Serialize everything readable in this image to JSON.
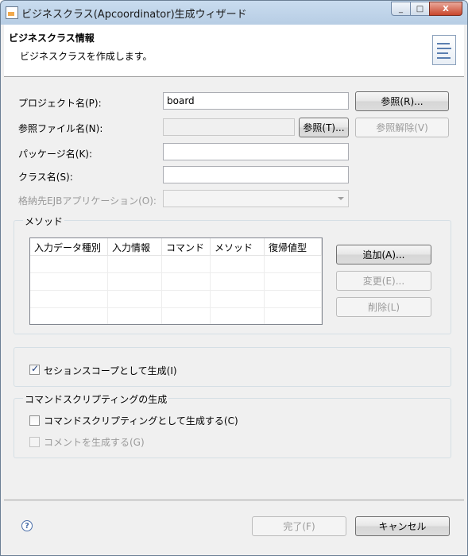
{
  "window": {
    "title": "ビジネスクラス(Apcoordinator)生成ウィザード",
    "minimize": "_",
    "maximize": "□",
    "close": "X"
  },
  "header": {
    "title": "ビジネスクラス情報",
    "description": "ビジネスクラスを作成します。"
  },
  "form": {
    "project_label": "プロジェクト名(P):",
    "project_value": "board",
    "browse_button": "参照(R)...",
    "ref_file_label": "参照ファイル名(N):",
    "ref_file_value": "",
    "ref_browse_button": "参照(T)...",
    "ref_clear_button": "参照解除(V)",
    "package_label": "パッケージ名(K):",
    "package_value": "",
    "class_label": "クラス名(S):",
    "class_value": "",
    "ejb_label": "格納先EJBアプリケーション(O):",
    "ejb_value": ""
  },
  "methods": {
    "group_title": "メソッド",
    "columns": [
      "入力データ種別",
      "入力情報",
      "コマンド",
      "メソッド",
      "復帰値型"
    ],
    "add_button": "追加(A)...",
    "edit_button": "変更(E)...",
    "delete_button": "削除(L)"
  },
  "session": {
    "checkbox_label": "セションスコープとして生成(I)",
    "checked": true
  },
  "scripting": {
    "group_title": "コマンドスクリプティングの生成",
    "generate_label": "コマンドスクリプティングとして生成する(C)",
    "generate_checked": false,
    "comment_label": "コメントを生成する(G)",
    "comment_checked": false
  },
  "footer": {
    "help_icon": "?",
    "finish_button": "完了(F)",
    "cancel_button": "キャンセル"
  }
}
